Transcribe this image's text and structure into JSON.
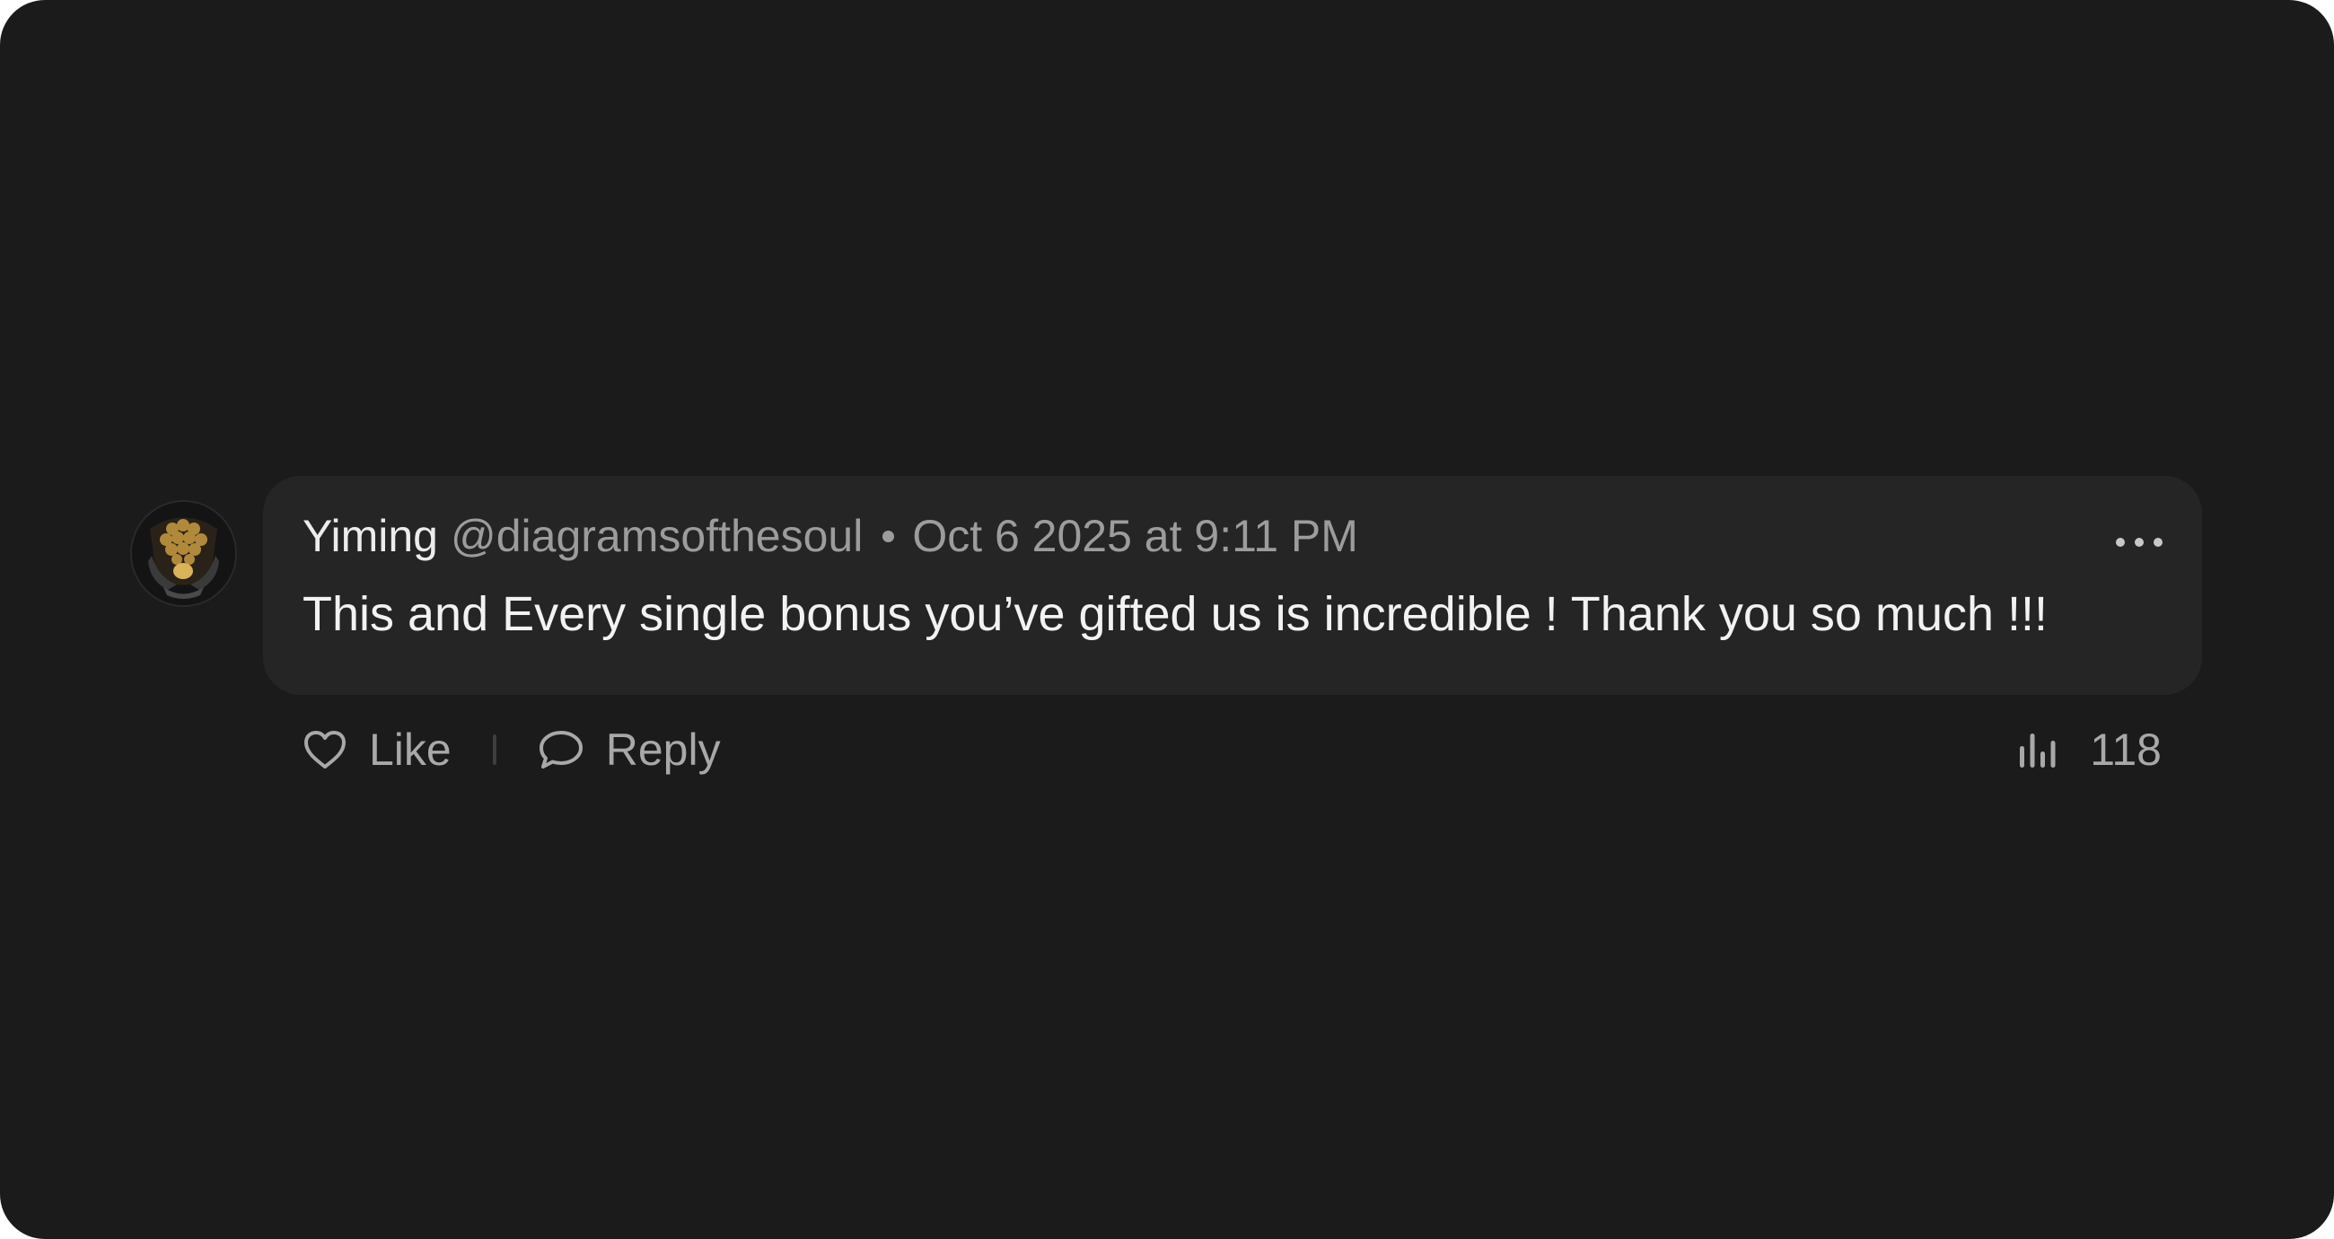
{
  "comment": {
    "author": "Yiming",
    "handle": "@diagramsofthesoul",
    "timestamp": "Oct 6 2025 at 9:11 PM",
    "body": "This and Every single bonus you’ve gifted us is incredible ! Thank you so much !!!"
  },
  "actions": {
    "like_label": "Like",
    "reply_label": "Reply",
    "views_count": "118"
  },
  "icons": {
    "avatar": "avatar-image",
    "more": "more-options-icon",
    "like": "heart-icon",
    "reply": "speech-bubble-icon",
    "views": "bar-chart-icon"
  },
  "colors": {
    "background": "#1b1b1b",
    "bubble": "#252525",
    "primary_text": "#f2f2f2",
    "secondary_text": "#9c9c9c",
    "avatar_accent": "#b08a3a"
  }
}
